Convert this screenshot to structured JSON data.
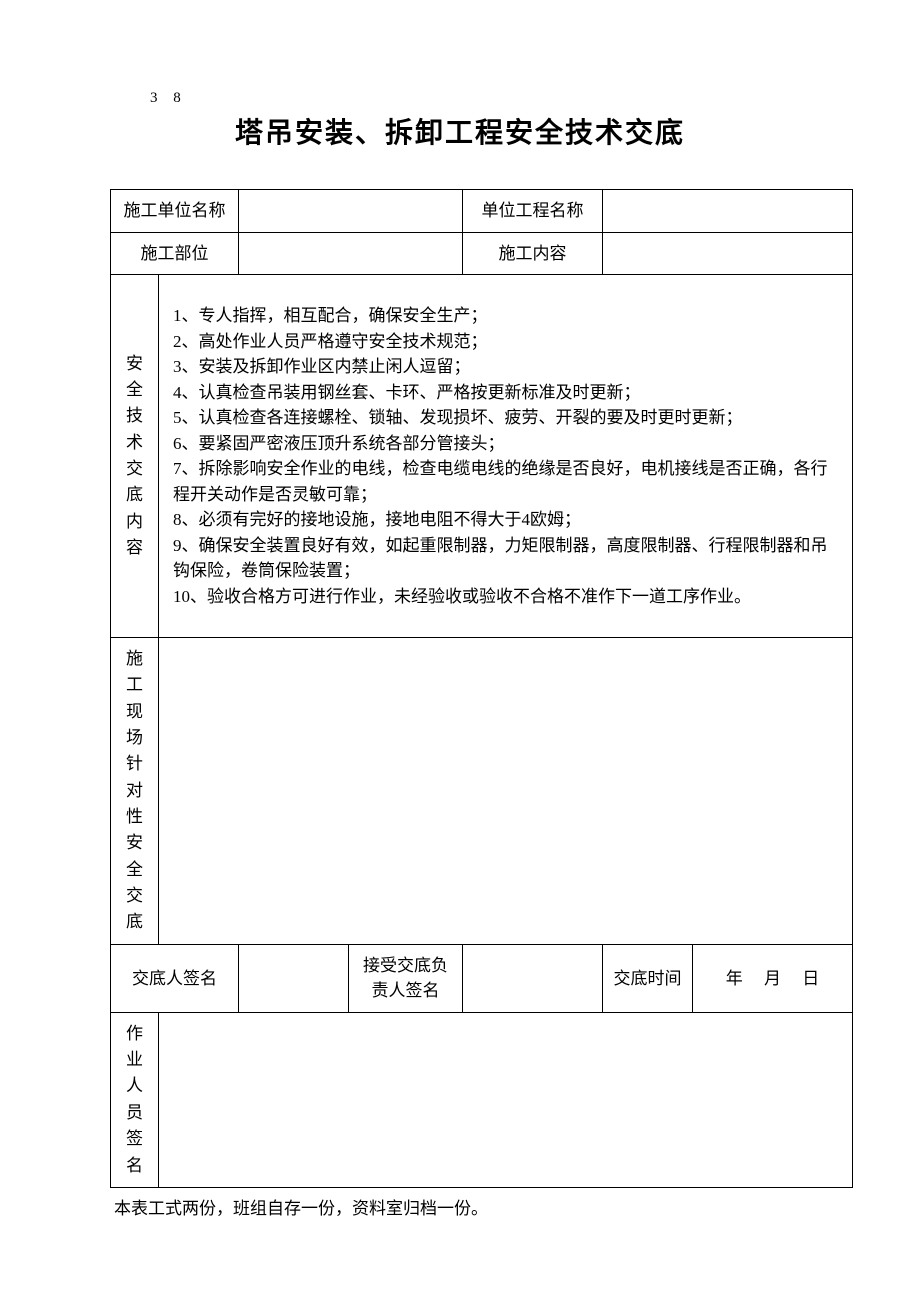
{
  "header_num": "3 8",
  "title": "塔吊安装、拆卸工程安全技术交底",
  "row1": {
    "label1": "施工单位名称",
    "val1": "",
    "label2": "单位工程名称",
    "val2": ""
  },
  "row2": {
    "label1": "施工部位",
    "val1": "",
    "label2": "施工内容",
    "val2": ""
  },
  "section1_label": "安全技术交底内容",
  "section1_lines": [
    "1、专人指挥，相互配合，确保安全生产；",
    "2、高处作业人员严格遵守安全技术规范；",
    "3、安装及拆卸作业区内禁止闲人逗留；",
    "4、认真检查吊装用钢丝套、卡环、严格按更新标准及时更新；",
    "5、认真检查各连接螺栓、锁轴、发现损坏、疲劳、开裂的要及时更时更新；",
    "6、要紧固严密液压顶升系统各部分管接头；",
    "7、拆除影响安全作业的电线，检查电缆电线的绝缘是否良好，电机接线是否正确，各行程开关动作是否灵敏可靠；",
    "8、必须有完好的接地设施，接地电阻不得大于4欧姆；",
    "9、确保安全装置良好有效，如起重限制器，力矩限制器，高度限制器、行程限制器和吊钩保险，卷筒保险装置；",
    "10、验收合格方可进行作业，未经验收或验收不合格不准作下一道工序作业。"
  ],
  "section2_label": "施工现场针对性安全交底",
  "sig_row": {
    "label1": "交底人签名",
    "val1": "",
    "label2": "接受交底负责人签名",
    "val2": "",
    "label3": "交底时间",
    "date": "年　 月　 日"
  },
  "section3_label": "作业人员签名",
  "footer": "本表工式两份，班组自存一份，资料室归档一份。"
}
